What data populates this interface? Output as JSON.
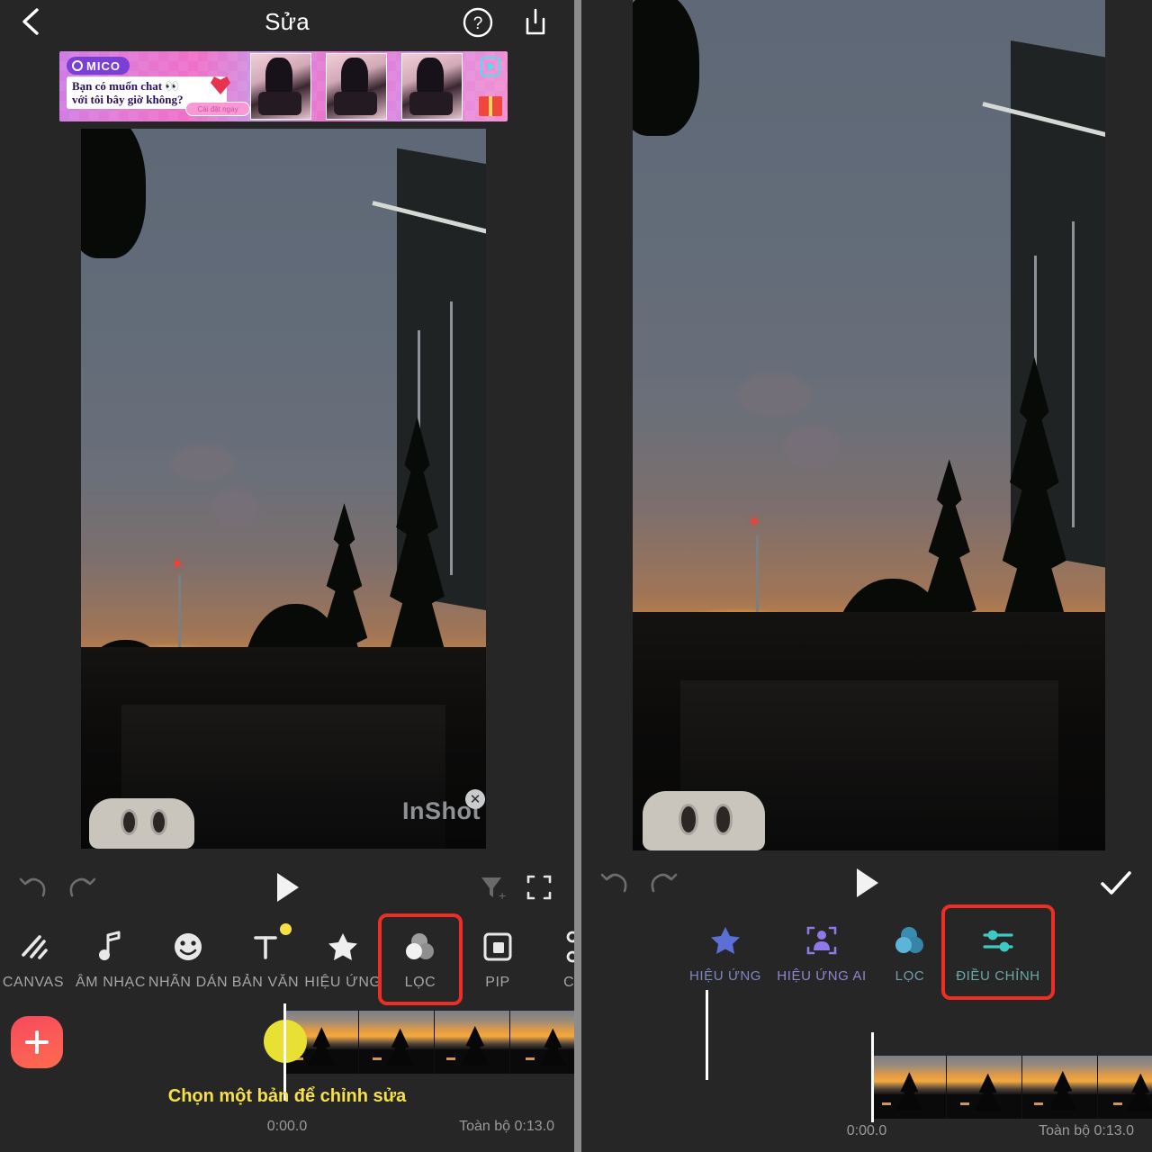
{
  "app": {
    "name": "InShot",
    "watermark": "InShot"
  },
  "left_panel": {
    "header": {
      "title": "Sửa",
      "back_icon": "chevron-left-icon",
      "help_icon": "question-mark-icon",
      "export_icon": "export-icon"
    },
    "ad": {
      "brand": "MICO",
      "line1": "Bạn có muốn chat 👀",
      "line2": "với tôi bây giờ không?",
      "cta": "Cài đặt ngay"
    },
    "controls": {
      "undo": "undo-icon",
      "redo": "redo-icon",
      "play": "play-icon",
      "funnel_add": "funnel-add-icon",
      "fullscreen": "fullscreen-icon"
    },
    "toolbar": [
      {
        "label": "CANVAS",
        "icon": "canvas-icon",
        "badge": false,
        "highlighted": false
      },
      {
        "label": "ÂM NHẠC",
        "icon": "music-icon",
        "badge": false,
        "highlighted": false
      },
      {
        "label": "NHÃN DÁN",
        "icon": "sticker-icon",
        "badge": false,
        "highlighted": false
      },
      {
        "label": "BẢN VĂN",
        "icon": "text-icon",
        "badge": true,
        "highlighted": false
      },
      {
        "label": "HIỆU ỨNG",
        "icon": "star-icon",
        "badge": false,
        "highlighted": false
      },
      {
        "label": "LỌC",
        "icon": "filter-icon",
        "badge": false,
        "highlighted": true
      },
      {
        "label": "PIP",
        "icon": "pip-icon",
        "badge": false,
        "highlighted": false
      },
      {
        "label": "CẮT",
        "icon": "scissors-icon",
        "badge": false,
        "highlighted": false
      }
    ],
    "timeline": {
      "add_label": "+",
      "hint": "Chọn một bản để chỉnh sửa",
      "current_time": "0:00.0",
      "total_time": "Toàn bộ 0:13.0"
    }
  },
  "right_panel": {
    "controls": {
      "undo": "undo-icon",
      "redo": "redo-icon",
      "play": "play-icon",
      "confirm": "check-icon"
    },
    "toolbar": [
      {
        "label": "HIỆU ỨNG",
        "icon": "star-icon",
        "color": "#5b6fd6",
        "highlighted": false
      },
      {
        "label": "HIỆU ỨNG AI",
        "icon": "ai-person-icon",
        "color": "#8f79e8",
        "highlighted": false
      },
      {
        "label": "LỌC",
        "icon": "filter-icon",
        "color": "#4fa8cc",
        "highlighted": false
      },
      {
        "label": "ĐIỀU CHỈNH",
        "icon": "sliders-icon",
        "color": "#3fc9c2",
        "highlighted": true
      }
    ],
    "timeline": {
      "current_time": "0:00.0",
      "total_time": "Toàn bộ 0:13.0"
    }
  },
  "colors": {
    "background": "#262626",
    "highlight_box": "#ee2d24",
    "accent_yellow": "#f5e04a",
    "add_button": "#f7485e",
    "divider": "#8c8c8c"
  }
}
